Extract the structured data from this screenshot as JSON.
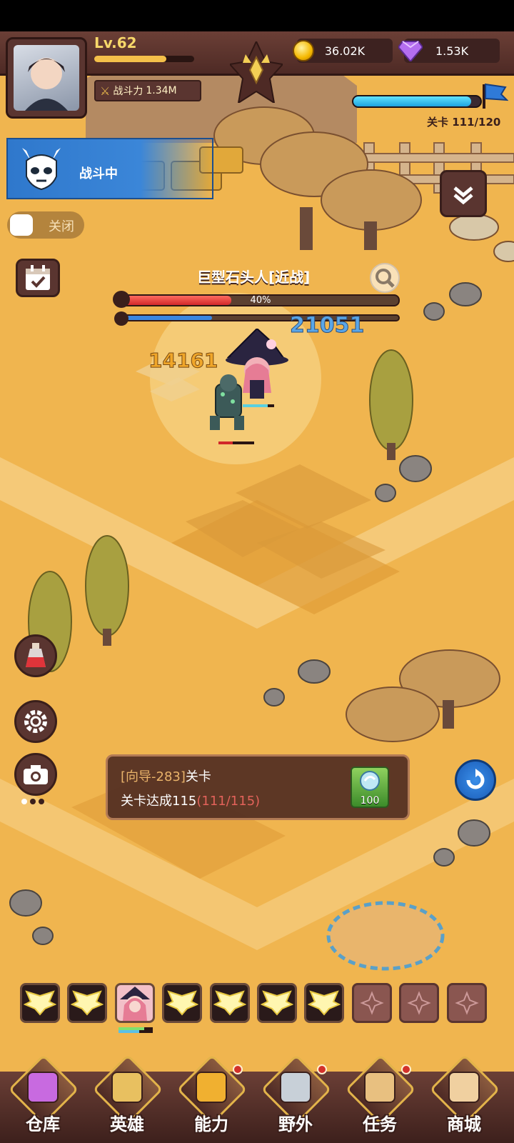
{
  "header": {
    "level": "Lv.62",
    "xp_fraction": 0.72,
    "power_label": "战斗力",
    "power_value": "1.34M",
    "gold": "36.02K",
    "gems": "1.53K",
    "stage_label": "关卡 111/120",
    "stage_progress_fraction": 0.925
  },
  "battle_banner": {
    "label": "战斗中"
  },
  "auto_toggle": {
    "label": "关闭"
  },
  "boss": {
    "name": "巨型石头人[近战]",
    "hp_percent_text": "40%",
    "hp_fraction": 0.4,
    "mp_fraction": 0.33
  },
  "damage_numbers": {
    "blue": "21051",
    "orange": "14161"
  },
  "quest": {
    "tag": "[向导-283]",
    "name": "关卡",
    "desc": "关卡达成115",
    "progress": "(111/115)",
    "reward_count": "100"
  },
  "hero_slots": [
    {
      "type": "locked-wings"
    },
    {
      "type": "locked-wings"
    },
    {
      "type": "hero-portrait"
    },
    {
      "type": "locked-wings"
    },
    {
      "type": "locked-wings"
    },
    {
      "type": "locked-wings"
    },
    {
      "type": "locked-wings"
    },
    {
      "type": "empty"
    },
    {
      "type": "empty"
    },
    {
      "type": "empty"
    }
  ],
  "nav": [
    {
      "label": "仓库",
      "badge": false
    },
    {
      "label": "英雄",
      "badge": false
    },
    {
      "label": "能力",
      "badge": true
    },
    {
      "label": "野外",
      "badge": true
    },
    {
      "label": "任务",
      "badge": true
    },
    {
      "label": "商城",
      "badge": false
    }
  ],
  "colors": {
    "ground": "#f0b54f",
    "panel": "#5a3530",
    "accent_blue": "#3a86e0",
    "hp_red": "#d1282a"
  }
}
